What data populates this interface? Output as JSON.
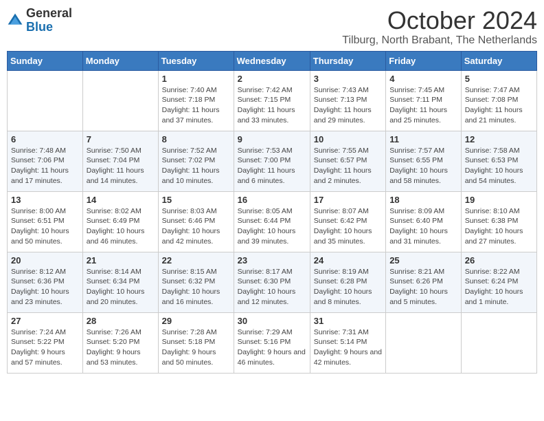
{
  "header": {
    "logo_general": "General",
    "logo_blue": "Blue",
    "month_title": "October 2024",
    "location": "Tilburg, North Brabant, The Netherlands"
  },
  "days_of_week": [
    "Sunday",
    "Monday",
    "Tuesday",
    "Wednesday",
    "Thursday",
    "Friday",
    "Saturday"
  ],
  "weeks": [
    [
      {
        "day": "",
        "info": ""
      },
      {
        "day": "",
        "info": ""
      },
      {
        "day": "1",
        "info": "Sunrise: 7:40 AM\nSunset: 7:18 PM\nDaylight: 11 hours and 37 minutes."
      },
      {
        "day": "2",
        "info": "Sunrise: 7:42 AM\nSunset: 7:15 PM\nDaylight: 11 hours and 33 minutes."
      },
      {
        "day": "3",
        "info": "Sunrise: 7:43 AM\nSunset: 7:13 PM\nDaylight: 11 hours and 29 minutes."
      },
      {
        "day": "4",
        "info": "Sunrise: 7:45 AM\nSunset: 7:11 PM\nDaylight: 11 hours and 25 minutes."
      },
      {
        "day": "5",
        "info": "Sunrise: 7:47 AM\nSunset: 7:08 PM\nDaylight: 11 hours and 21 minutes."
      }
    ],
    [
      {
        "day": "6",
        "info": "Sunrise: 7:48 AM\nSunset: 7:06 PM\nDaylight: 11 hours and 17 minutes."
      },
      {
        "day": "7",
        "info": "Sunrise: 7:50 AM\nSunset: 7:04 PM\nDaylight: 11 hours and 14 minutes."
      },
      {
        "day": "8",
        "info": "Sunrise: 7:52 AM\nSunset: 7:02 PM\nDaylight: 11 hours and 10 minutes."
      },
      {
        "day": "9",
        "info": "Sunrise: 7:53 AM\nSunset: 7:00 PM\nDaylight: 11 hours and 6 minutes."
      },
      {
        "day": "10",
        "info": "Sunrise: 7:55 AM\nSunset: 6:57 PM\nDaylight: 11 hours and 2 minutes."
      },
      {
        "day": "11",
        "info": "Sunrise: 7:57 AM\nSunset: 6:55 PM\nDaylight: 10 hours and 58 minutes."
      },
      {
        "day": "12",
        "info": "Sunrise: 7:58 AM\nSunset: 6:53 PM\nDaylight: 10 hours and 54 minutes."
      }
    ],
    [
      {
        "day": "13",
        "info": "Sunrise: 8:00 AM\nSunset: 6:51 PM\nDaylight: 10 hours and 50 minutes."
      },
      {
        "day": "14",
        "info": "Sunrise: 8:02 AM\nSunset: 6:49 PM\nDaylight: 10 hours and 46 minutes."
      },
      {
        "day": "15",
        "info": "Sunrise: 8:03 AM\nSunset: 6:46 PM\nDaylight: 10 hours and 42 minutes."
      },
      {
        "day": "16",
        "info": "Sunrise: 8:05 AM\nSunset: 6:44 PM\nDaylight: 10 hours and 39 minutes."
      },
      {
        "day": "17",
        "info": "Sunrise: 8:07 AM\nSunset: 6:42 PM\nDaylight: 10 hours and 35 minutes."
      },
      {
        "day": "18",
        "info": "Sunrise: 8:09 AM\nSunset: 6:40 PM\nDaylight: 10 hours and 31 minutes."
      },
      {
        "day": "19",
        "info": "Sunrise: 8:10 AM\nSunset: 6:38 PM\nDaylight: 10 hours and 27 minutes."
      }
    ],
    [
      {
        "day": "20",
        "info": "Sunrise: 8:12 AM\nSunset: 6:36 PM\nDaylight: 10 hours and 23 minutes."
      },
      {
        "day": "21",
        "info": "Sunrise: 8:14 AM\nSunset: 6:34 PM\nDaylight: 10 hours and 20 minutes."
      },
      {
        "day": "22",
        "info": "Sunrise: 8:15 AM\nSunset: 6:32 PM\nDaylight: 10 hours and 16 minutes."
      },
      {
        "day": "23",
        "info": "Sunrise: 8:17 AM\nSunset: 6:30 PM\nDaylight: 10 hours and 12 minutes."
      },
      {
        "day": "24",
        "info": "Sunrise: 8:19 AM\nSunset: 6:28 PM\nDaylight: 10 hours and 8 minutes."
      },
      {
        "day": "25",
        "info": "Sunrise: 8:21 AM\nSunset: 6:26 PM\nDaylight: 10 hours and 5 minutes."
      },
      {
        "day": "26",
        "info": "Sunrise: 8:22 AM\nSunset: 6:24 PM\nDaylight: 10 hours and 1 minute."
      }
    ],
    [
      {
        "day": "27",
        "info": "Sunrise: 7:24 AM\nSunset: 5:22 PM\nDaylight: 9 hours and 57 minutes."
      },
      {
        "day": "28",
        "info": "Sunrise: 7:26 AM\nSunset: 5:20 PM\nDaylight: 9 hours and 53 minutes."
      },
      {
        "day": "29",
        "info": "Sunrise: 7:28 AM\nSunset: 5:18 PM\nDaylight: 9 hours and 50 minutes."
      },
      {
        "day": "30",
        "info": "Sunrise: 7:29 AM\nSunset: 5:16 PM\nDaylight: 9 hours and 46 minutes."
      },
      {
        "day": "31",
        "info": "Sunrise: 7:31 AM\nSunset: 5:14 PM\nDaylight: 9 hours and 42 minutes."
      },
      {
        "day": "",
        "info": ""
      },
      {
        "day": "",
        "info": ""
      }
    ]
  ]
}
